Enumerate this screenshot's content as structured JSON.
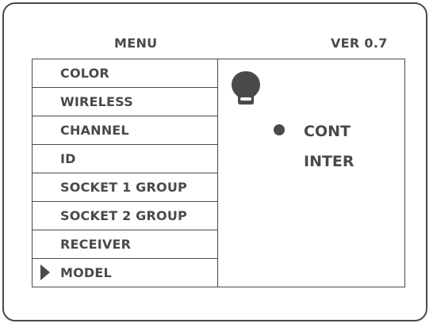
{
  "header": {
    "menu_label": "MENU",
    "version_label": "VER 0.7"
  },
  "menu": {
    "items": [
      {
        "label": "COLOR",
        "selected": false
      },
      {
        "label": "WIRELESS",
        "selected": false
      },
      {
        "label": "CHANNEL",
        "selected": false
      },
      {
        "label": "ID",
        "selected": false
      },
      {
        "label": "SOCKET 1 GROUP",
        "selected": false
      },
      {
        "label": "SOCKET 2 GROUP",
        "selected": false
      },
      {
        "label": "RECEIVER",
        "selected": false
      },
      {
        "label": "MODEL",
        "selected": true
      }
    ]
  },
  "detail": {
    "icon": "light-bulb-icon",
    "options": [
      {
        "label": "CONT",
        "selected": true
      },
      {
        "label": "INTER",
        "selected": false
      }
    ]
  },
  "colors": {
    "foreground": "#4a4a4a",
    "background": "#ffffff"
  }
}
